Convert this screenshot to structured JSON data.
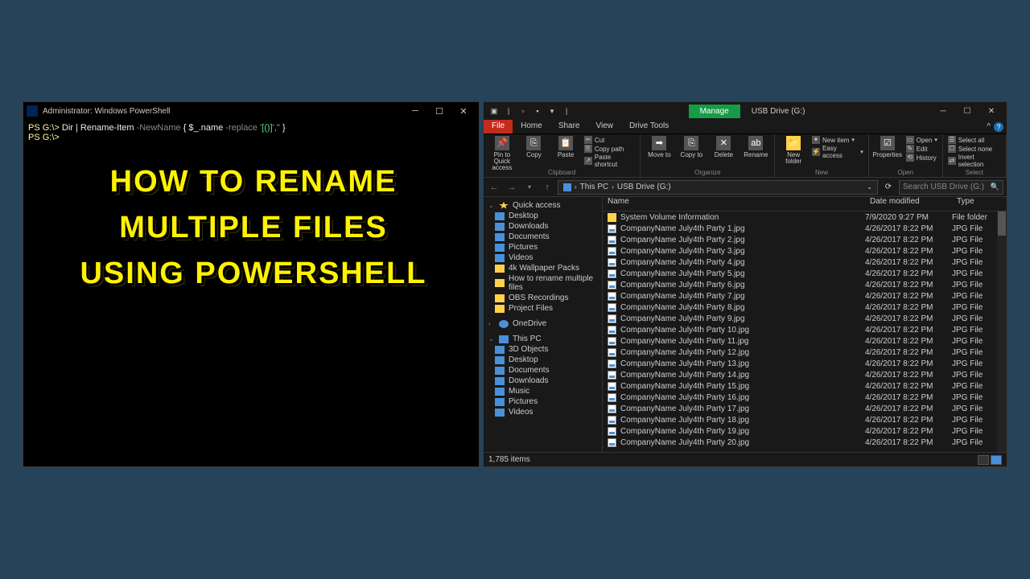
{
  "powershell": {
    "title": "Administrator: Windows PowerShell",
    "line1_prompt": "PS G:\\>",
    "line1_cmd": " Dir | Rename-Item ",
    "line1_param": "-NewName ",
    "line1_brace_open": "{ ",
    "line1_var": "$_.name ",
    "line1_op": "-replace ",
    "line1_str": "'[()]',''",
    "line1_brace_close": " }",
    "line2_prompt": "PS G:\\>"
  },
  "overlay": {
    "line1": "How To Rename",
    "line2": "multiple files",
    "line3": "using powershell"
  },
  "explorer": {
    "manage_tab": "Manage",
    "location_tab": "USB Drive (G:)",
    "menu": {
      "file": "File",
      "home": "Home",
      "share": "Share",
      "view": "View",
      "drivetools": "Drive Tools"
    },
    "ribbon": {
      "pin": "Pin to Quick access",
      "copy": "Copy",
      "paste": "Paste",
      "cut": "Cut",
      "copypath": "Copy path",
      "pasteshortcut": "Paste shortcut",
      "clipboard_label": "Clipboard",
      "moveto": "Move to",
      "copyto": "Copy to",
      "delete": "Delete",
      "rename": "Rename",
      "organize_label": "Organize",
      "newfolder": "New folder",
      "newitem": "New item",
      "easyaccess": "Easy access",
      "new_label": "New",
      "properties": "Properties",
      "open": "Open",
      "edit": "Edit",
      "history": "History",
      "open_label": "Open",
      "selectall": "Select all",
      "selectnone": "Select none",
      "invert": "Invert selection",
      "select_label": "Select"
    },
    "breadcrumb": {
      "thispc": "This PC",
      "sep": "›",
      "drive": "USB Drive (G:)"
    },
    "search_placeholder": "Search USB Drive (G:)",
    "sidebar": {
      "quick": "Quick access",
      "desktop": "Desktop",
      "downloads": "Downloads",
      "documents": "Documents",
      "pictures": "Pictures",
      "videos": "Videos",
      "wallpaper": "4k Wallpaper Packs",
      "howto": "How to rename multiple files",
      "obs": "OBS Recordings",
      "project": "Project Files",
      "onedrive": "OneDrive",
      "thispc": "This PC",
      "objects3d": "3D Objects",
      "desktop2": "Desktop",
      "documents2": "Documents",
      "downloads2": "Downloads",
      "music": "Music",
      "pictures2": "Pictures",
      "videos2": "Videos"
    },
    "columns": {
      "name": "Name",
      "date": "Date modified",
      "type": "Type"
    },
    "folder_row": {
      "name": "System Volume Information",
      "date": "7/9/2020 9:27 PM",
      "type": "File folder"
    },
    "file_template": {
      "prefix": "CompanyName July4th Party ",
      "suffix": ".jpg",
      "date": "4/26/2017 8:22 PM",
      "type": "JPG File",
      "count": 20
    },
    "status": "1,785 items"
  }
}
